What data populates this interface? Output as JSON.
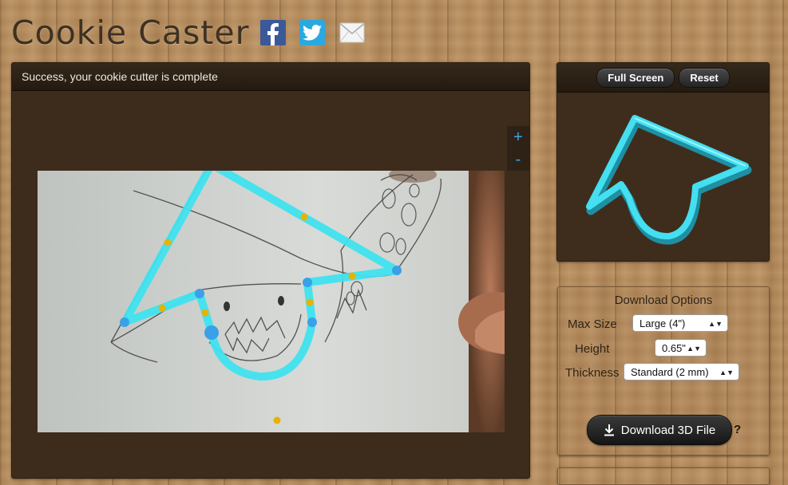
{
  "app": {
    "logo": "Cookie Caster"
  },
  "social": {
    "facebook_icon": "facebook-icon",
    "twitter_icon": "twitter-icon",
    "email_icon": "email-icon"
  },
  "editor": {
    "status": "Success, your cookie cutter is complete",
    "zoom_in": "+",
    "zoom_out": "-"
  },
  "preview": {
    "full_screen": "Full Screen",
    "reset": "Reset"
  },
  "download": {
    "title": "Download Options",
    "max_size_label": "Max Size",
    "max_size_value": "Large (4\")",
    "height_label": "Height",
    "height_value": "0.65\"",
    "thickness_label": "Thickness",
    "thickness_value": "Standard (2 mm)",
    "button": "Download 3D File",
    "help": "?"
  },
  "colors": {
    "outline": "#3fe3ef",
    "node": "#3aa0e8",
    "midpoint": "#e8b200"
  }
}
